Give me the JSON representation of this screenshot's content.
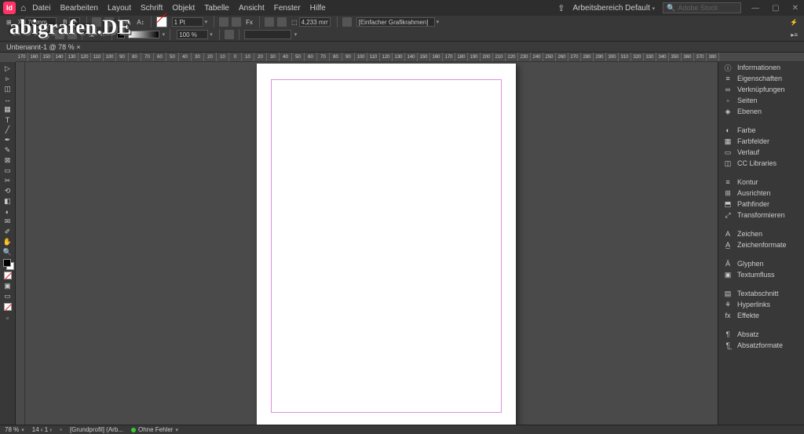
{
  "app_badge": "Id",
  "menu": [
    "Datei",
    "Bearbeiten",
    "Layout",
    "Schrift",
    "Objekt",
    "Tabelle",
    "Ansicht",
    "Fenster",
    "Hilfe"
  ],
  "workspace_label": "Arbeitsbereich Default",
  "search_placeholder": "Adobe Stock",
  "control": {
    "x_label": "X:",
    "x_value": "76 mm",
    "b_label": "B",
    "stroke_weight": "1 Pt",
    "opacity": "100 %",
    "gap_value": "4,233 mm",
    "frame_style": "[Einfacher Grafikrahmen]"
  },
  "document_tab": "Unbenannt-1 @ 78 %",
  "watermark": "abigrafen.DE",
  "ruler_values": [
    "170",
    "160",
    "150",
    "140",
    "130",
    "120",
    "110",
    "100",
    "90",
    "80",
    "70",
    "60",
    "50",
    "40",
    "30",
    "20",
    "10",
    "0",
    "10",
    "20",
    "30",
    "40",
    "50",
    "60",
    "70",
    "80",
    "90",
    "100",
    "110",
    "120",
    "130",
    "140",
    "150",
    "160",
    "170",
    "180",
    "190",
    "200",
    "210",
    "220",
    "230",
    "240",
    "250",
    "260",
    "270",
    "280",
    "290",
    "300",
    "310",
    "320",
    "330",
    "340",
    "350",
    "360",
    "370",
    "380"
  ],
  "panels": {
    "g1": [
      {
        "icon": "ⓘ",
        "label": "Informationen"
      },
      {
        "icon": "≡",
        "label": "Eigenschaften"
      },
      {
        "icon": "∞",
        "label": "Verknüpfungen"
      },
      {
        "icon": "▫",
        "label": "Seiten"
      },
      {
        "icon": "◈",
        "label": "Ebenen"
      }
    ],
    "g2": [
      {
        "icon": "◐",
        "label": "Farbe"
      },
      {
        "icon": "▦",
        "label": "Farbfelder"
      },
      {
        "icon": "▭",
        "label": "Verlauf"
      },
      {
        "icon": "◫",
        "label": "CC Libraries"
      }
    ],
    "g3": [
      {
        "icon": "≡",
        "label": "Kontur"
      },
      {
        "icon": "⊞",
        "label": "Ausrichten"
      },
      {
        "icon": "⬒",
        "label": "Pathfinder"
      },
      {
        "icon": "⤢",
        "label": "Transformieren"
      }
    ],
    "g4": [
      {
        "icon": "A",
        "label": "Zeichen"
      },
      {
        "icon": "A̲",
        "label": "Zeichenformate"
      }
    ],
    "g5": [
      {
        "icon": "Ä",
        "label": "Glyphen"
      },
      {
        "icon": "▣",
        "label": "Textumfluss"
      }
    ],
    "g6": [
      {
        "icon": "▤",
        "label": "Textabschnitt"
      },
      {
        "icon": "⚘",
        "label": "Hyperlinks"
      },
      {
        "icon": "fx",
        "label": "Effekte"
      }
    ],
    "g7": [
      {
        "icon": "¶",
        "label": "Absatz"
      },
      {
        "icon": "¶̲",
        "label": "Absatzformate"
      }
    ]
  },
  "status": {
    "zoom": "78 %",
    "pages": "14 ‹ 1 ›",
    "profile": "[Grundprofil] (Arb...",
    "errors": "Ohne Fehler"
  }
}
